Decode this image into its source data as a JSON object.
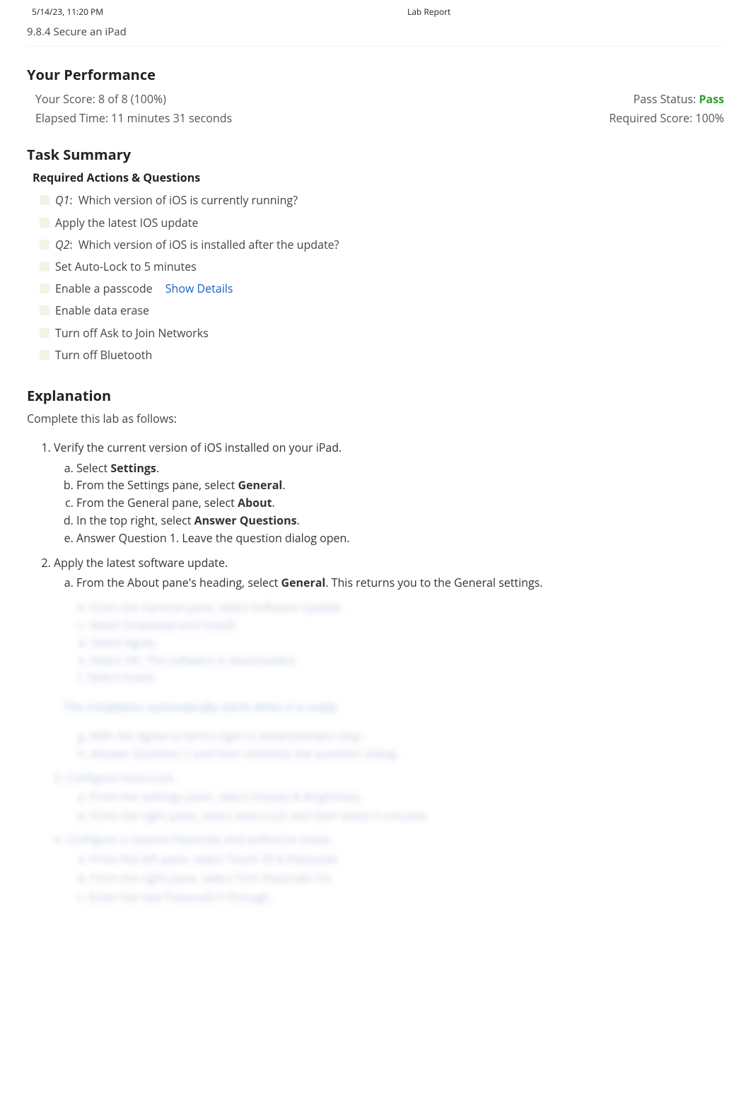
{
  "print": {
    "timestamp": "5/14/23, 11:20 PM",
    "title": "Lab Report"
  },
  "lab_title": "9.8.4 Secure an iPad",
  "performance": {
    "heading": "Your Performance",
    "score_label": "Your Score: 8 of 8 (100%)",
    "elapsed_label": "Elapsed Time: 11 minutes 31 seconds",
    "pass_status_label": "Pass Status: ",
    "pass_status_value": "Pass",
    "required_label": "Required Score: 100%"
  },
  "task": {
    "heading": "Task Summary",
    "required_heading": "Required Actions & Questions",
    "items": [
      {
        "q": "Q1",
        "sep": ":",
        "text": "Which version of iOS is currently running?"
      },
      {
        "text": "Apply the latest IOS update"
      },
      {
        "q": "Q2",
        "sep": ":",
        "text": "Which version of iOS is installed after the update?"
      },
      {
        "text": "Set Auto-Lock to 5 minutes"
      },
      {
        "text": "Enable a passcode",
        "link": "Show Details"
      },
      {
        "text": "Enable data erase"
      },
      {
        "text": "Turn off Ask to Join Networks"
      },
      {
        "text": "Turn off Bluetooth"
      }
    ]
  },
  "explanation": {
    "heading": "Explanation",
    "intro": "Complete this lab as follows:",
    "step1": {
      "title": "Verify the current version of iOS installed on your iPad.",
      "a_pre": "Select ",
      "a_b": "Settings",
      "a_post": ".",
      "b_pre": "From the Settings pane, select ",
      "b_b": "General",
      "b_post": ".",
      "c_pre": "From the General pane, select ",
      "c_b": "About",
      "c_post": ".",
      "d_pre": "In the top right, select ",
      "d_b": "Answer Questions",
      "d_post": ".",
      "e": "Answer Question 1. Leave the question dialog open."
    },
    "step2": {
      "title": "Apply the latest software update.",
      "a_pre": "From the About pane's heading, select ",
      "a_b": "General",
      "a_post": ". This returns you to the General settings."
    },
    "blur": {
      "l1": "b. From the General pane, select Software Update.",
      "l2": "c. Select Download and Install.",
      "l3": "d. Select Agree.",
      "l4": "e. Select OK. The software is downloaded.",
      "l5": "f. Select Install.",
      "callout": "The installation automatically starts when it is ready.",
      "l6": "g. With the Agree to terms right in advertisement step.",
      "l7": "h. Answer Question 2 and then minimize the question dialog.",
      "s3": "3. Configure Auto-Lock.",
      "s3a": "a. From the Settings pane, select Display & Brightness.",
      "s3b": "b. From the right pane, select Auto-Lock and then select 5 minutes.",
      "s4": "4. Configure a require Passcode and authorize erase.",
      "s4a": "a. From the left pane, select Touch ID & Passcode.",
      "s4b": "b. From the right pane, select Turn Passcode On.",
      "s4c": "c. Enter the new Passcode 0 through."
    }
  }
}
